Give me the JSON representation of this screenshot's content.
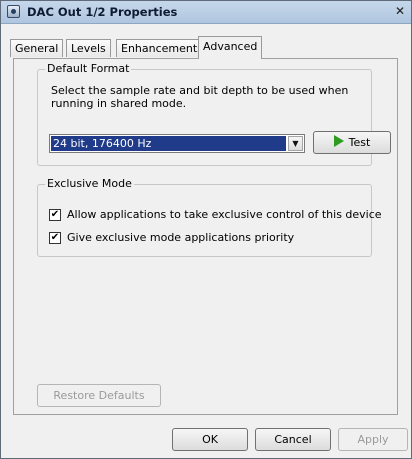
{
  "window": {
    "title": "DAC Out 1/2 Properties",
    "close_glyph": "✕"
  },
  "tabs": [
    {
      "label": "General"
    },
    {
      "label": "Levels"
    },
    {
      "label": "Enhancements"
    },
    {
      "label": "Advanced",
      "active": true
    }
  ],
  "default_format": {
    "group_label": "Default Format",
    "description": "Select the sample rate and bit depth to be used when running in shared mode.",
    "selected_value": "24 bit, 176400 Hz",
    "test_label": "Test"
  },
  "exclusive_mode": {
    "group_label": "Exclusive Mode",
    "options": [
      {
        "label": "Allow applications to take exclusive control of this device",
        "checked": true
      },
      {
        "label": "Give exclusive mode applications priority",
        "checked": true
      }
    ]
  },
  "buttons": {
    "restore_defaults": "Restore Defaults",
    "ok": "OK",
    "cancel": "Cancel",
    "apply": "Apply"
  },
  "colors": {
    "selection": "#1f3b8a",
    "test_icon": "#2e9c21",
    "disabled_text": "#9a9a9a"
  },
  "icons": [
    "speaker-app-icon",
    "close-icon",
    "dropdown-arrow-icon",
    "play-icon",
    "checkmark-icon"
  ]
}
